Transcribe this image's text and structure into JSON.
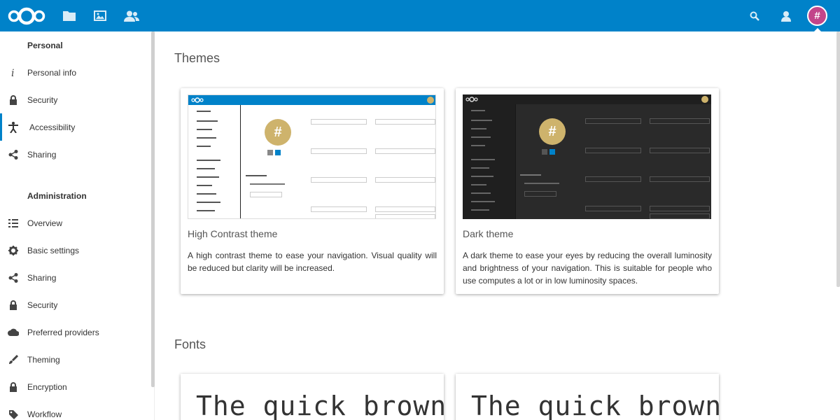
{
  "header": {
    "logo_icon": "nextcloud-logo",
    "nav": [
      {
        "icon": "files-icon"
      },
      {
        "icon": "photos-icon"
      },
      {
        "icon": "contacts-icon"
      }
    ],
    "search_icon": "search-icon",
    "contacts_menu_icon": "contacts-menu-icon",
    "avatar_initial": "#",
    "colors": {
      "primary": "#0082c9",
      "avatar": "#c2458a"
    }
  },
  "sidebar": {
    "personal_heading": "Personal",
    "personal_items": [
      {
        "label": "Personal info",
        "icon": "info-icon"
      },
      {
        "label": "Security",
        "icon": "lock-icon"
      },
      {
        "label": "Accessibility",
        "icon": "accessibility-icon",
        "active": true
      },
      {
        "label": "Sharing",
        "icon": "share-icon"
      }
    ],
    "admin_heading": "Administration",
    "admin_items": [
      {
        "label": "Overview",
        "icon": "list-icon"
      },
      {
        "label": "Basic settings",
        "icon": "gear-icon"
      },
      {
        "label": "Sharing",
        "icon": "share-icon"
      },
      {
        "label": "Security",
        "icon": "lock-icon"
      },
      {
        "label": "Preferred providers",
        "icon": "cloud-icon"
      },
      {
        "label": "Theming",
        "icon": "brush-icon"
      },
      {
        "label": "Encryption",
        "icon": "lock-icon"
      },
      {
        "label": "Workflow",
        "icon": "tag-icon"
      }
    ]
  },
  "main": {
    "themes_title": "Themes",
    "themes": [
      {
        "name": "High Contrast theme",
        "description": "A high contrast theme to ease your navigation. Visual quality will be reduced but clarity will be increased.",
        "style": "light"
      },
      {
        "name": "Dark theme",
        "description": "A dark theme to ease your eyes by reducing the overall luminosity and brightness of your navigation. This is suitable for people who use computes a lot or in low luminosity spaces.",
        "style": "dark"
      }
    ],
    "fonts_title": "Fonts",
    "font_samples": [
      {
        "text": "The quick brown"
      },
      {
        "text": "The quick brown"
      }
    ]
  }
}
